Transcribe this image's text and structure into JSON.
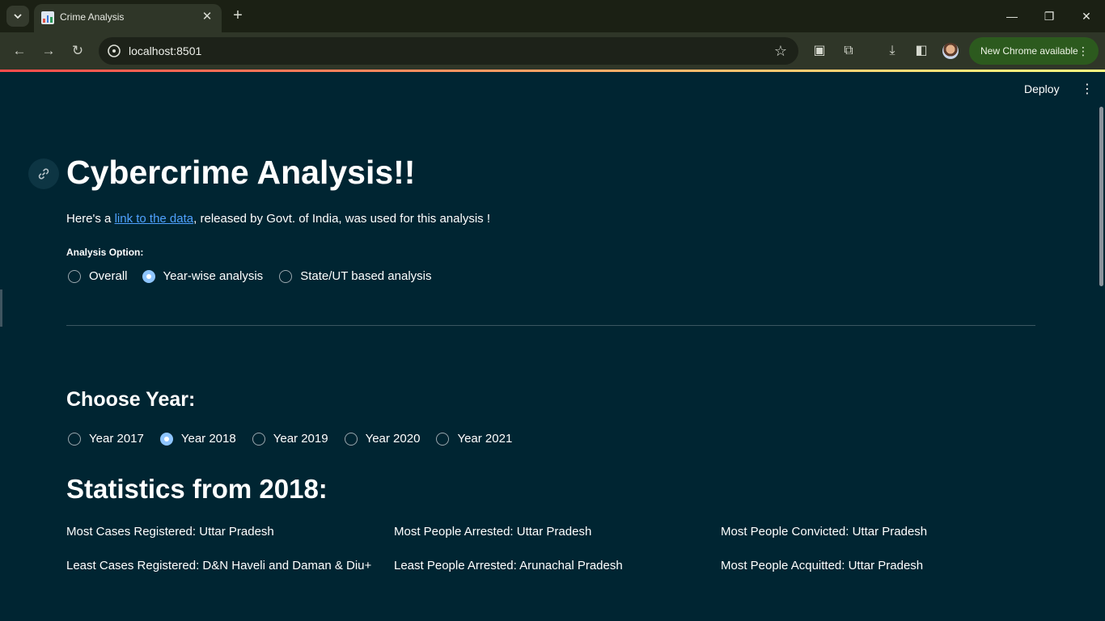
{
  "browser": {
    "tab_title": "Crime Analysis",
    "url": "localhost:8501",
    "update_chip": "New Chrome available"
  },
  "app": {
    "deploy_label": "Deploy",
    "title": "Cybercrime Analysis!!",
    "intro_prefix": "Here's a ",
    "intro_link": "link to the data",
    "intro_suffix": ", released by Govt. of India, was used for this analysis !",
    "analysis_label": "Analysis Option:",
    "analysis_options": [
      "Overall",
      "Year-wise analysis",
      "State/UT based analysis"
    ],
    "analysis_selected": "Year-wise analysis",
    "year_heading": "Choose Year:",
    "years": [
      "Year 2017",
      "Year 2018",
      "Year 2019",
      "Year 2020",
      "Year 2021"
    ],
    "year_selected": "Year 2018",
    "stats_heading": "Statistics from 2018:",
    "stats": [
      "Most Cases Registered: Uttar Pradesh",
      "Most People Arrested: Uttar Pradesh",
      "Most People Convicted: Uttar Pradesh",
      "Least Cases Registered: D&N Haveli and Daman & Diu+",
      "Least People Arrested: Arunachal Pradesh",
      "Most People Acquitted: Uttar Pradesh"
    ]
  },
  "colors": {
    "app_background": "#002532",
    "link": "#4fa2ff",
    "radio_selected": "#8ec5ff",
    "update_chip": "#2c5a1e"
  }
}
